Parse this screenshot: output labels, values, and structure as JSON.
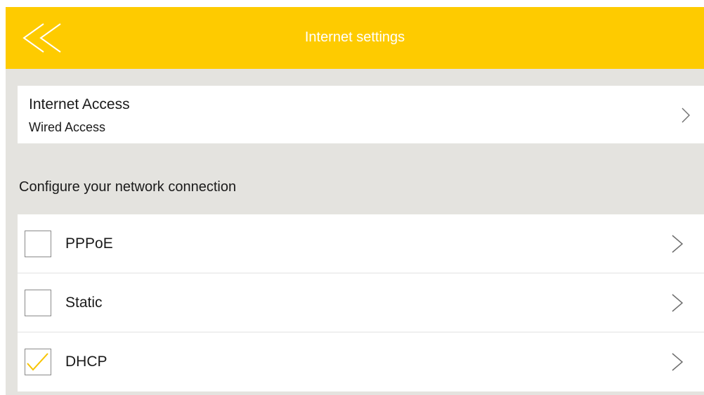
{
  "header": {
    "title": "Internet settings",
    "back_icon": "double-chevron-left-icon"
  },
  "access": {
    "title": "Internet Access",
    "value": "Wired Access",
    "chevron_icon": "chevron-right-icon"
  },
  "section": {
    "heading": "Configure your network connection"
  },
  "options": [
    {
      "label": "PPPoE",
      "checked": false
    },
    {
      "label": "Static",
      "checked": false
    },
    {
      "label": "DHCP",
      "checked": true
    }
  ],
  "colors": {
    "accent": "#fecb00",
    "background": "#e4e3df",
    "card": "#ffffff",
    "check": "#f8c400"
  }
}
